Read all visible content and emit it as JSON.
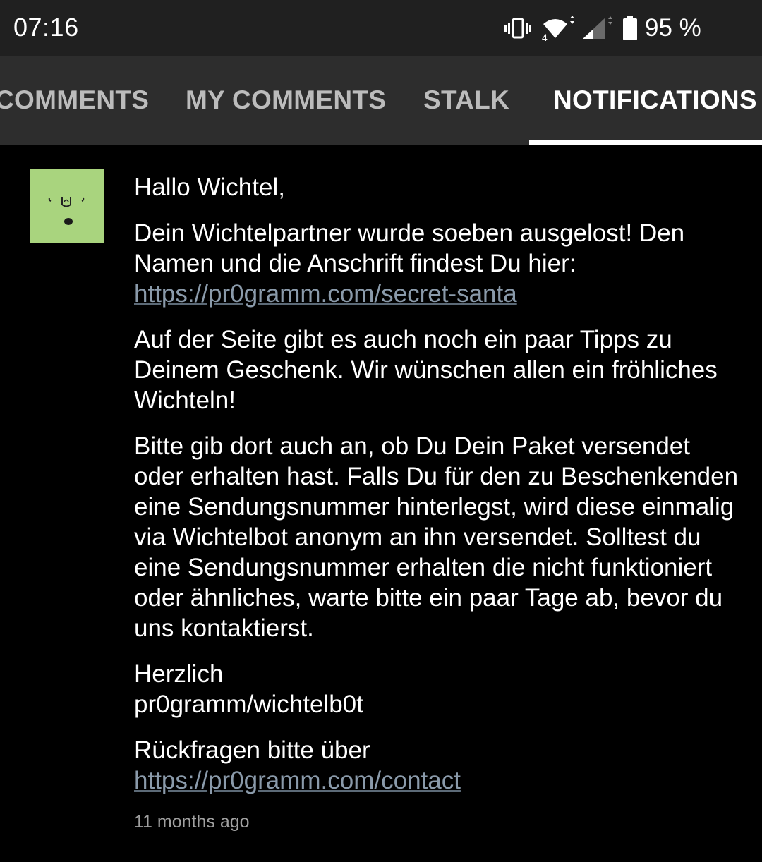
{
  "status_bar": {
    "time": "07:16",
    "battery_percent": "95 %",
    "network_label": "4",
    "icons": [
      "vibrate-icon",
      "wifi-icon",
      "signal-icon",
      "battery-icon"
    ]
  },
  "tabs": [
    {
      "label": "COMMENTS",
      "active": false
    },
    {
      "label": "MY COMMENTS",
      "active": false
    },
    {
      "label": "STALK",
      "active": false
    },
    {
      "label": "NOTIFICATIONS",
      "active": true
    }
  ],
  "notification": {
    "greeting": "Hallo Wichtel,",
    "para1_text": "Dein Wichtelpartner wurde soeben ausgelost! Den Namen und die Anschrift findest Du hier:",
    "para1_link": "https://pr0gramm.com/secret-santa",
    "para2": "Auf der Seite gibt es auch noch ein paar Tipps zu Deinem Geschenk. Wir wünschen allen ein fröhliches Wichteln!",
    "para3": "Bitte gib dort auch an, ob Du Dein Paket versendet oder erhalten hast. Falls Du für den zu Beschenkenden eine Sendungsnummer hinterlegst, wird diese einmalig via Wichtelbot anonym an ihn versendet. Solltest du eine Sendungsnummer erhalten die nicht funktioniert oder ähnliches, warte bitte ein paar Tage ab, bevor du uns kontaktierst.",
    "sign_line1": "Herzlich",
    "sign_line2": "pr0gramm/wichtelb0t",
    "contact_text": "Rückfragen bitte über",
    "contact_link": "https://pr0gramm.com/contact",
    "timestamp": "11 months ago"
  },
  "colors": {
    "status_bar_bg": "#202020",
    "tab_bar_bg": "#2d2d2d",
    "background": "#000000",
    "avatar_bg": "#a9d47e",
    "link": "#8a9aaa",
    "timestamp": "#a0a0a0"
  }
}
